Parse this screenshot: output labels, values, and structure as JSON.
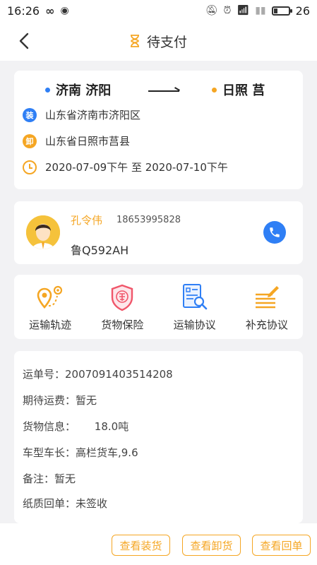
{
  "status_bar": {
    "time": "16:26",
    "battery": "26",
    "battery_level": 0.26
  },
  "header": {
    "title": "待支付"
  },
  "route": {
    "from_city": "济南 济阳",
    "to_city": "日照 莒",
    "load_badge": "装",
    "load_address": "山东省济南市济阳区",
    "unload_badge": "卸",
    "unload_address": "山东省日照市莒县",
    "time_range": "2020-07-09下午 至 2020-07-10下午"
  },
  "driver": {
    "name": "孔令伟",
    "phone": "18653995828",
    "plate": "鲁Q592AH"
  },
  "services": [
    {
      "label": "运输轨迹",
      "icon": "route-pin-icon"
    },
    {
      "label": "货物保险",
      "icon": "insurance-shield-icon"
    },
    {
      "label": "运输协议",
      "icon": "agreement-search-icon"
    },
    {
      "label": "补充协议",
      "icon": "supplement-edit-icon"
    }
  ],
  "details": {
    "waybill": "运单号：2007091403514208",
    "expected_fee": "期待运费：暂无",
    "cargo_label": "货物信息：",
    "cargo_value": "18.0吨",
    "vehicle": "车型车长：高栏货车,9.6",
    "remark": "备注：暂无",
    "paper_receipt": "纸质回单：未签收"
  },
  "actions": {
    "view_loading": "查看装货",
    "view_unloading": "查看卸货",
    "view_receipt": "查看回单"
  },
  "colors": {
    "accent": "#f5a623",
    "blue": "#2f7ff5",
    "from_dot": "#2f7ff5",
    "to_dot": "#f5a623"
  }
}
